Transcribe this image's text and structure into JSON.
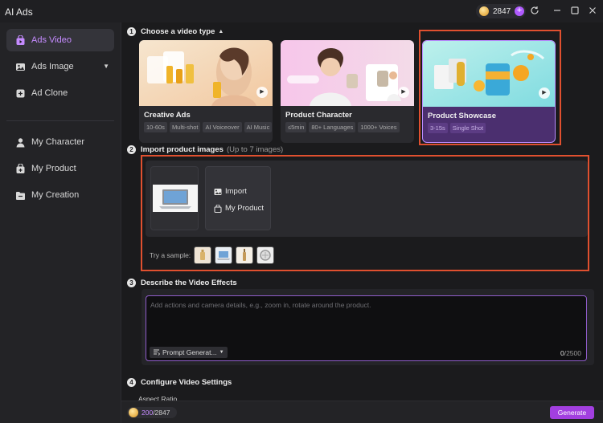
{
  "app": {
    "title": "AI Ads"
  },
  "titlebar": {
    "credits": "2847",
    "plus": "+"
  },
  "sidebar": {
    "items": [
      {
        "label": "Ads Video"
      },
      {
        "label": "Ads Image"
      },
      {
        "label": "Ad Clone"
      },
      {
        "label": "My Character"
      },
      {
        "label": "My Product"
      },
      {
        "label": "My Creation"
      }
    ]
  },
  "steps": {
    "s1": {
      "num": "1",
      "title": "Choose a video type"
    },
    "s2": {
      "num": "2",
      "title": "Import product images",
      "hint": "(Up to 7 images)"
    },
    "s3": {
      "num": "3",
      "title": "Describe the Video Effects"
    },
    "s4": {
      "num": "4",
      "title": "Configure Video Settings"
    }
  },
  "video_types": [
    {
      "title": "Creative Ads",
      "tags": [
        "10-60s",
        "Multi-shot",
        "AI Voiceover",
        "AI Music"
      ]
    },
    {
      "title": "Product Character",
      "tags": [
        "≤5min",
        "80+ Languages",
        "1000+ Voices"
      ]
    },
    {
      "title": "Product Showcase",
      "tags": [
        "3-15s",
        "Single Shot"
      ]
    }
  ],
  "import": {
    "import_label": "Import",
    "my_product_label": "My Product",
    "try_sample": "Try a sample:"
  },
  "effects": {
    "placeholder": "Add actions and camera details, e.g., zoom in, rotate around the product.",
    "prompt_generator": "Prompt Generat...",
    "count_current": "0",
    "count_max": "/2500"
  },
  "settings": {
    "aspect_ratio_label": "Aspect Ratio"
  },
  "bottom": {
    "used": "200",
    "total": "/2847",
    "generate": "Generate"
  },
  "colors": {
    "accent": "#a23fe0",
    "highlight_frame": "#e0502f",
    "active_text": "#c58bff"
  }
}
